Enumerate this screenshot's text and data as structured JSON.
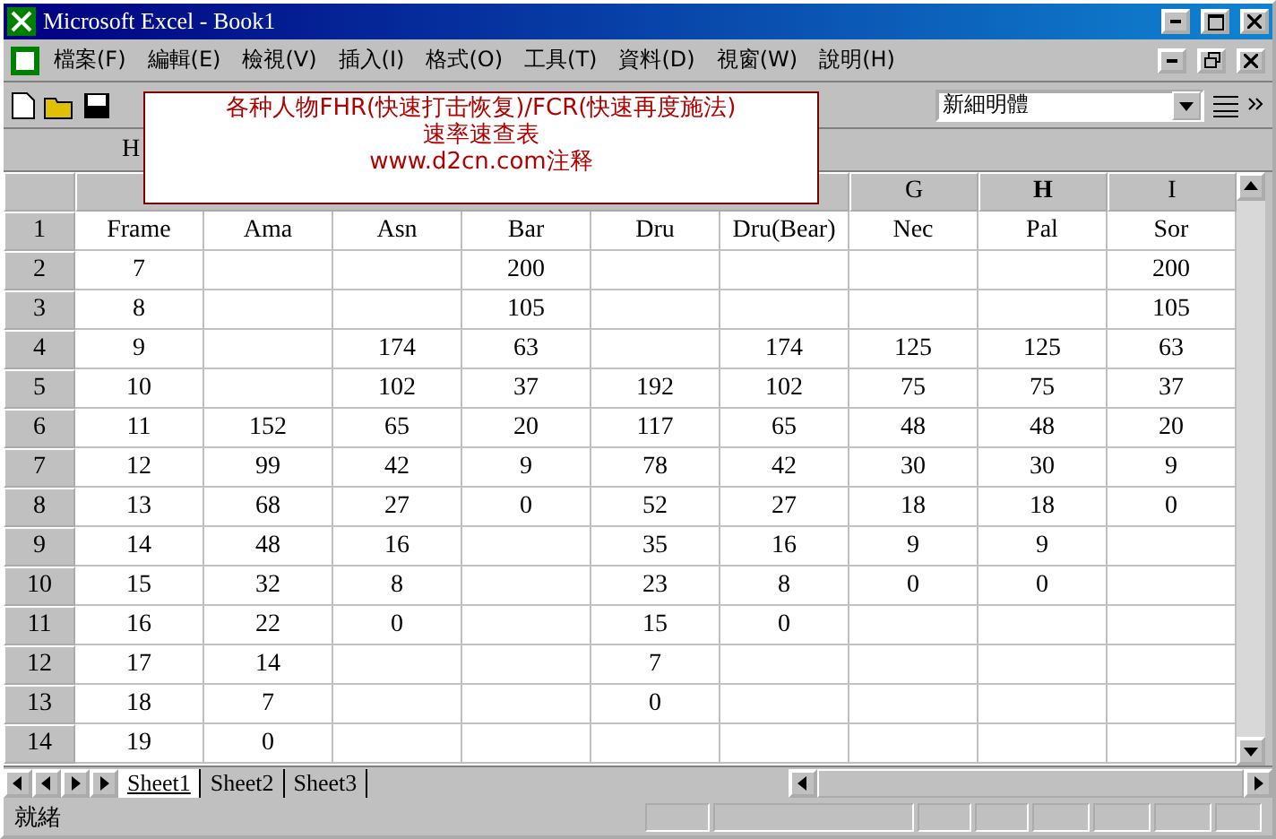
{
  "window": {
    "title": "Microsoft Excel - Book1"
  },
  "menu": [
    "檔案(F)",
    "編輯(E)",
    "檢視(V)",
    "插入(I)",
    "格式(O)",
    "工具(T)",
    "資料(D)",
    "視窗(W)",
    "說明(H)"
  ],
  "toolbar": {
    "font": "新細明體"
  },
  "formula_bar": {
    "name_box": "H"
  },
  "note": {
    "lines": [
      "各种人物FHR(快速打击恢复)/FCR(快速再度施法)",
      "速率速查表",
      "www.d2cn.com注释"
    ]
  },
  "sheet": {
    "columns": [
      null,
      null,
      null,
      null,
      null,
      null,
      {
        "label": "G",
        "selected": false
      },
      {
        "label": "H",
        "selected": true
      },
      {
        "label": "I",
        "selected": false
      }
    ],
    "rows": [
      [
        "1",
        [
          "Frame",
          "Ama",
          "Asn",
          "Bar",
          "Dru",
          "Dru(Bear)",
          "Nec",
          "Pal",
          "Sor"
        ]
      ],
      [
        "2",
        [
          "7",
          null,
          null,
          "200",
          null,
          null,
          null,
          null,
          "200"
        ]
      ],
      [
        "3",
        [
          "8",
          null,
          null,
          "105",
          null,
          null,
          null,
          null,
          "105"
        ]
      ],
      [
        "4",
        [
          "9",
          null,
          "174",
          "63",
          null,
          "174",
          "125",
          "125",
          "63"
        ]
      ],
      [
        "5",
        [
          "10",
          null,
          "102",
          "37",
          "192",
          "102",
          "75",
          "75",
          "37"
        ]
      ],
      [
        "6",
        [
          "11",
          "152",
          "65",
          "20",
          "117",
          "65",
          "48",
          "48",
          "20"
        ]
      ],
      [
        "7",
        [
          "12",
          "99",
          "42",
          "9",
          "78",
          "42",
          "30",
          "30",
          "9"
        ]
      ],
      [
        "8",
        [
          "13",
          "68",
          "27",
          "0",
          "52",
          "27",
          "18",
          "18",
          "0"
        ]
      ],
      [
        "9",
        [
          "14",
          "48",
          "16",
          null,
          "35",
          "16",
          "9",
          "9",
          null
        ]
      ],
      [
        "10",
        [
          "15",
          "32",
          "8",
          null,
          "23",
          "8",
          "0",
          "0",
          null
        ]
      ],
      [
        "11",
        [
          "16",
          "22",
          "0",
          null,
          "15",
          "0",
          null,
          null,
          null
        ]
      ],
      [
        "12",
        [
          "17",
          "14",
          null,
          null,
          "7",
          null,
          null,
          null,
          null
        ]
      ],
      [
        "13",
        [
          "18",
          "7",
          null,
          null,
          "0",
          null,
          null,
          null,
          null
        ]
      ],
      [
        "14",
        [
          "19",
          "0",
          null,
          null,
          null,
          null,
          null,
          null,
          null
        ]
      ]
    ]
  },
  "sheet_tabs": [
    {
      "label": "Sheet1",
      "selected": true
    },
    {
      "label": "Sheet2",
      "selected": false
    },
    {
      "label": "Sheet3",
      "selected": false
    }
  ],
  "status_bar": {
    "text": "就緒"
  }
}
